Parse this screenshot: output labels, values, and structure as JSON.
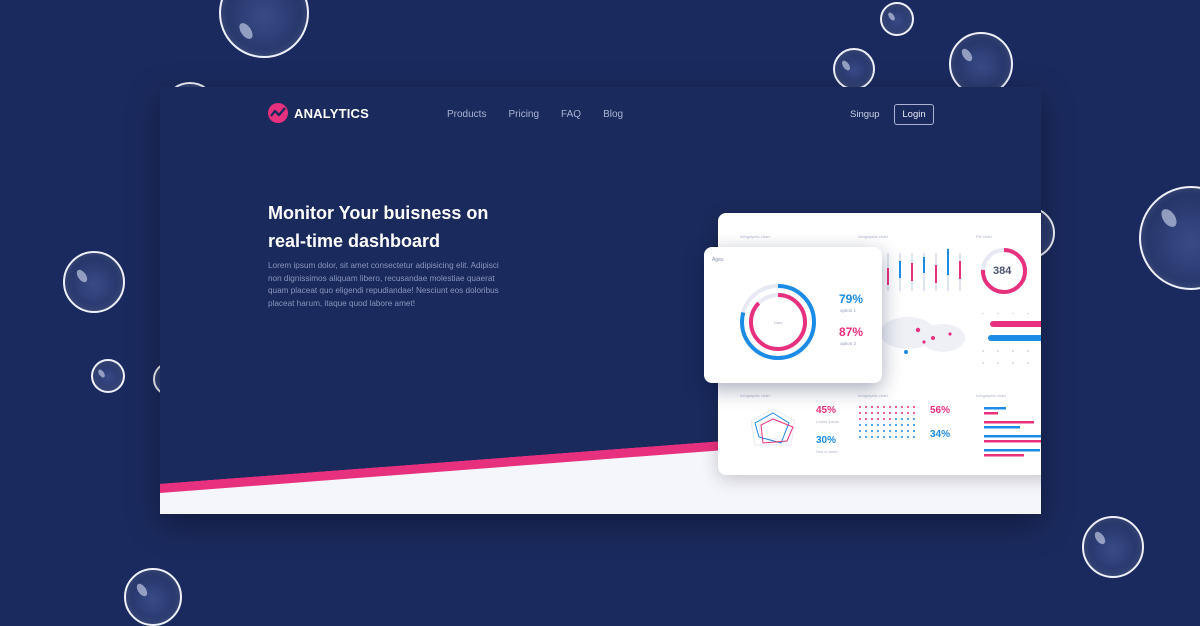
{
  "app": {
    "logo_text": "ANALYTICS",
    "nav": [
      "Products",
      "Pricing",
      "FAQ",
      "Blog"
    ],
    "signup_label": "Singup",
    "login_label": "Login"
  },
  "hero": {
    "title_line1": "Monitor Your buisness on",
    "title_line2": "real-time dashboard",
    "text": "Lorem ipsum dolor, sit amet consectetur adipisicing elit. Adipisci non dignissimos aliquam libero, recusandae molestiae quaerat quam placeat quo eligendi repudiandae! Nesciunt eos doloribus placeat harum, itaque quod labore amet!"
  },
  "dashboard": {
    "popup": {
      "label": "Ages",
      "center_label": "Data",
      "value1": "79%",
      "label1": "option 1",
      "value2": "87%",
      "label2": "option 2"
    },
    "widget_titles": [
      "Infographic chart",
      "Infographic chart",
      "Pie chart",
      "Infographic chart",
      "Infographic chart",
      "Infographic chart"
    ],
    "gauge_value": "384",
    "stats_left": {
      "v1": "45%",
      "v2": "30%",
      "l1": "Lorem ipsum",
      "l2": "Sed ut amet"
    },
    "stats_right": {
      "v1": "56%",
      "v2": "34%"
    }
  },
  "colors": {
    "background": "#1b2a5e",
    "window": "#1a2a5c",
    "accent_pink": "#e8317e",
    "accent_blue": "#1c8be6"
  }
}
